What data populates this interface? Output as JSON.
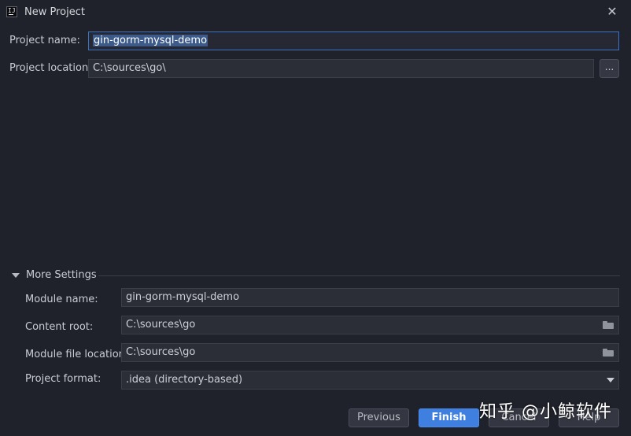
{
  "window": {
    "title": "New Project",
    "app_icon_text": "IJ"
  },
  "form": {
    "project_name_label": "Project name:",
    "project_name_value": "gin-gorm-mysql-demo",
    "project_location_label": "Project location:",
    "project_location_value": "C:\\sources\\go\\",
    "browse_label": "..."
  },
  "more_settings": {
    "title": "More Settings",
    "module_name_label": "Module name:",
    "module_name_value": "gin-gorm-mysql-demo",
    "content_root_label": "Content root:",
    "content_root_value": "C:\\sources\\go",
    "module_file_location_label": "Module file location:",
    "module_file_location_value": "C:\\sources\\go",
    "project_format_label": "Project format:",
    "project_format_value": ".idea (directory-based)"
  },
  "buttons": {
    "previous": "Previous",
    "finish": "Finish",
    "cancel": "Cancel",
    "help": "Help"
  },
  "watermark": "知乎 @小鲸软件"
}
